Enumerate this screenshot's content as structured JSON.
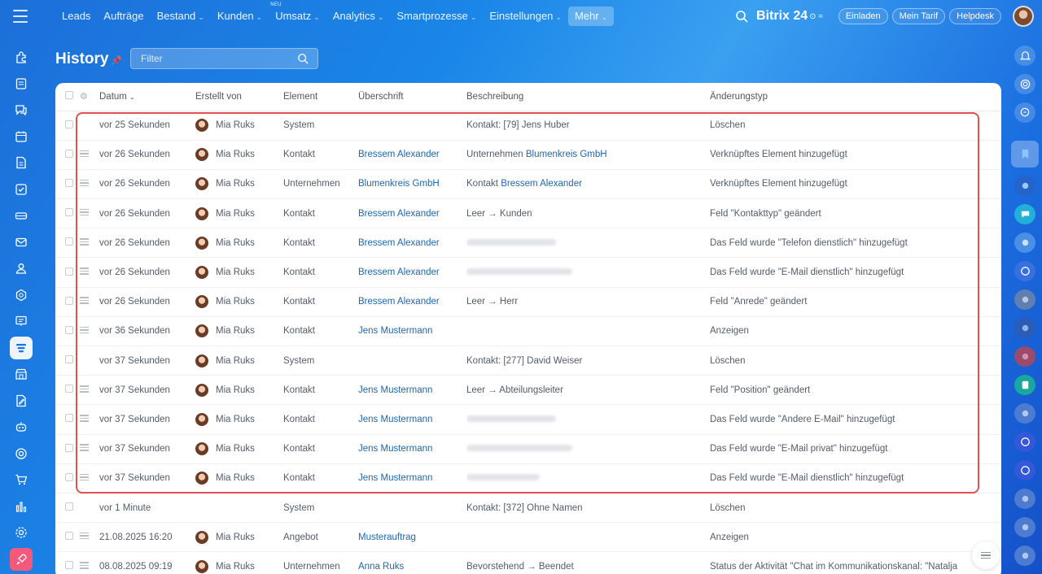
{
  "topnav": {
    "items": [
      {
        "label": "Leads",
        "chevron": false
      },
      {
        "label": "Aufträge",
        "chevron": false
      },
      {
        "label": "Bestand",
        "chevron": true
      },
      {
        "label": "Kunden",
        "chevron": true
      },
      {
        "label": "Umsatz",
        "chevron": true,
        "badge": "NEU"
      },
      {
        "label": "Analytics",
        "chevron": true
      },
      {
        "label": "Smartprozesse",
        "chevron": true
      },
      {
        "label": "Einstellungen",
        "chevron": true
      },
      {
        "label": "Mehr",
        "chevron": true,
        "active": true
      }
    ],
    "brand": "Bitrix",
    "brand_number": "24",
    "buttons": [
      "Einladen",
      "Mein Tarif",
      "Helpdesk"
    ]
  },
  "page": {
    "title": "History",
    "filter_placeholder": "Filter"
  },
  "table": {
    "columns": [
      "Datum",
      "Erstellt von",
      "Element",
      "Überschrift",
      "Beschreibung",
      "Änderungstyp"
    ],
    "rows": [
      {
        "datum": "vor 25 Sekunden",
        "user": "Mia Ruks",
        "element": "System",
        "title": "",
        "desc_pre": "Kontakt: [79] Jens Huber",
        "desc_link": "",
        "type": "Löschen",
        "drag": false
      },
      {
        "datum": "vor 26 Sekunden",
        "user": "Mia Ruks",
        "element": "Kontakt",
        "title": "Bressem Alexander",
        "desc_pre": "Unternehmen ",
        "desc_link": "Blumenkreis GmbH",
        "type": "Verknüpftes Element hinzugefügt",
        "drag": true
      },
      {
        "datum": "vor 26 Sekunden",
        "user": "Mia Ruks",
        "element": "Unternehmen",
        "title": "Blumenkreis GmbH",
        "desc_pre": "Kontakt ",
        "desc_link": "Bressem Alexander",
        "type": "Verknüpftes Element hinzugefügt",
        "drag": true
      },
      {
        "datum": "vor 26 Sekunden",
        "user": "Mia Ruks",
        "element": "Kontakt",
        "title": "Bressem Alexander",
        "desc_pre": "Leer → Kunden",
        "desc_link": "",
        "type": "Feld \"Kontakttyp\" geändert",
        "drag": true
      },
      {
        "datum": "vor 26 Sekunden",
        "user": "Mia Ruks",
        "element": "Kontakt",
        "title": "Bressem Alexander",
        "desc_pre": "",
        "desc_link": "",
        "blurred": true,
        "type": "Das Feld wurde \"Telefon dienstlich\" hinzugefügt",
        "drag": true
      },
      {
        "datum": "vor 26 Sekunden",
        "user": "Mia Ruks",
        "element": "Kontakt",
        "title": "Bressem Alexander",
        "desc_pre": "",
        "desc_link": "",
        "blurred": true,
        "type": "Das Feld wurde \"E-Mail dienstlich\" hinzugefügt",
        "drag": true
      },
      {
        "datum": "vor 26 Sekunden",
        "user": "Mia Ruks",
        "element": "Kontakt",
        "title": "Bressem Alexander",
        "desc_pre": "Leer → Herr",
        "desc_link": "",
        "type": "Feld \"Anrede\" geändert",
        "drag": true
      },
      {
        "datum": "vor 36 Sekunden",
        "user": "Mia Ruks",
        "element": "Kontakt",
        "title": "Jens Mustermann",
        "desc_pre": "",
        "desc_link": "",
        "type": "Anzeigen",
        "drag": true
      },
      {
        "datum": "vor 37 Sekunden",
        "user": "Mia Ruks",
        "element": "System",
        "title": "",
        "desc_pre": "Kontakt: [277] David Weiser",
        "desc_link": "",
        "type": "Löschen",
        "drag": false
      },
      {
        "datum": "vor 37 Sekunden",
        "user": "Mia Ruks",
        "element": "Kontakt",
        "title": "Jens Mustermann",
        "desc_pre": "Leer → Abteilungsleiter",
        "desc_link": "",
        "type": "Feld \"Position\" geändert",
        "drag": true
      },
      {
        "datum": "vor 37 Sekunden",
        "user": "Mia Ruks",
        "element": "Kontakt",
        "title": "Jens Mustermann",
        "desc_pre": "",
        "desc_link": "",
        "blurred": true,
        "type": "Das Feld wurde \"Andere E-Mail\" hinzugefügt",
        "drag": true
      },
      {
        "datum": "vor 37 Sekunden",
        "user": "Mia Ruks",
        "element": "Kontakt",
        "title": "Jens Mustermann",
        "desc_pre": "",
        "desc_link": "",
        "blurred": true,
        "type": "Das Feld wurde \"E-Mail privat\" hinzugefügt",
        "drag": true
      },
      {
        "datum": "vor 37 Sekunden",
        "user": "Mia Ruks",
        "element": "Kontakt",
        "title": "Jens Mustermann",
        "desc_pre": "",
        "desc_link": "",
        "blurred": true,
        "type": "Das Feld wurde \"E-Mail dienstlich\" hinzugefügt",
        "drag": true
      },
      {
        "datum": "vor 1 Minute",
        "user": "",
        "element": "System",
        "title": "",
        "desc_pre": "Kontakt: [372] Ohne Namen",
        "desc_link": "",
        "type": "Löschen",
        "drag": false
      },
      {
        "datum": "21.08.2025 16:20",
        "user": "Mia Ruks",
        "element": "Angebot",
        "title": "Musterauftrag",
        "desc_pre": "",
        "desc_link": "",
        "type": "Anzeigen",
        "drag": true
      },
      {
        "datum": "08.08.2025 09:19",
        "user": "Mia Ruks",
        "element": "Unternehmen",
        "title": "Anna Ruks",
        "desc_pre": "Bevorstehend → Beendet",
        "desc_link": "",
        "type": "Status der Aktivität \"Chat im Kommunikationskanal: \"Natalja",
        "drag": true
      }
    ]
  },
  "colors": {
    "accent": "#2067b0",
    "highlight": "#e25050",
    "background": "#1a86e8"
  }
}
